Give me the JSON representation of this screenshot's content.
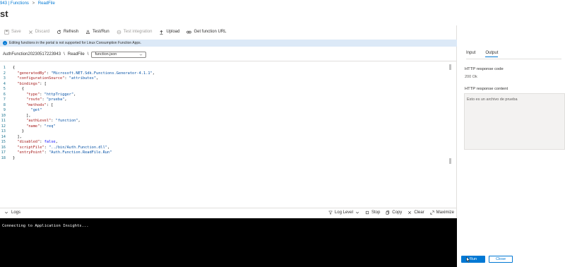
{
  "breadcrumb": {
    "part1": "943 | Functions",
    "sep": ">",
    "part2": "ReadFile"
  },
  "page_title": "st",
  "toolbar": {
    "save": "Save",
    "discard": "Discard",
    "refresh": "Refresh",
    "test_run": "Test/Run",
    "test_integration": "Test integration",
    "upload": "Upload",
    "get_function_url": "Get function URL"
  },
  "info_message": "Editing functions in the portal is not supported for Linux Consumption Function Apps.",
  "path": {
    "app": "AuthFunction20230517223943",
    "sep1": "\\",
    "function": "ReadFile",
    "sep2": "\\",
    "file": "function.json"
  },
  "code_lines": [
    {
      "n": "1",
      "text": "{"
    },
    {
      "n": "2",
      "text": "  \"generatedBy\": \"Microsoft.NET.Sdk.Functions.Generator-4.1.1\","
    },
    {
      "n": "3",
      "text": "  \"configurationSource\": \"attributes\","
    },
    {
      "n": "4",
      "text": "  \"bindings\": ["
    },
    {
      "n": "5",
      "text": "    {"
    },
    {
      "n": "6",
      "text": "      \"type\": \"httpTrigger\","
    },
    {
      "n": "7",
      "text": "      \"route\": \"prueba\","
    },
    {
      "n": "8",
      "text": "      \"methods\": ["
    },
    {
      "n": "9",
      "text": "        \"get\""
    },
    {
      "n": "10",
      "text": "      ],"
    },
    {
      "n": "11",
      "text": "      \"authLevel\": \"function\","
    },
    {
      "n": "12",
      "text": "      \"name\": \"req\""
    },
    {
      "n": "13",
      "text": "    }"
    },
    {
      "n": "14",
      "text": "  ],"
    },
    {
      "n": "15",
      "text": "  \"disabled\": false,"
    },
    {
      "n": "16",
      "text": "  \"scriptFile\": \"../bin/Auth.Function.dll\","
    },
    {
      "n": "17",
      "text": "  \"entryPoint\": \"Auth.Function.ReadFile.Run\""
    },
    {
      "n": "18",
      "text": "}"
    }
  ],
  "logs": {
    "title": "Logs",
    "log_level": "Log Level",
    "stop": "Stop",
    "copy": "Copy",
    "clear": "Clear",
    "maximize": "Maximize",
    "console_text": "Connecting to Application Insights..."
  },
  "right": {
    "tab_input": "Input",
    "tab_output": "Output",
    "response_code_label": "HTTP response code",
    "response_code_value": "200 Ok",
    "response_content_label": "HTTP response content",
    "response_content_value": "Esto es un archivo de prueba",
    "run_button": "Run",
    "close_button": "Close"
  },
  "colors": {
    "accent": "#0078d4",
    "info_bg": "#dce9f7",
    "console_bg": "#000000"
  }
}
